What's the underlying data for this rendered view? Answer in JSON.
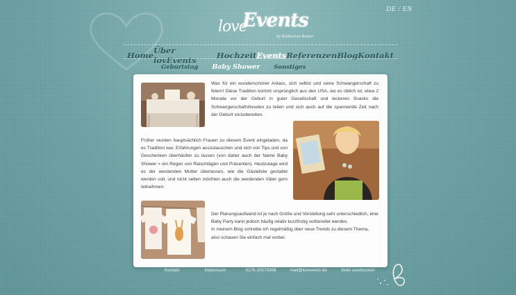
{
  "lang": {
    "de": "DE",
    "separator": "/",
    "en": "EN"
  },
  "logo": {
    "love": "love",
    "events": "Events",
    "byline": "by Katharina Romer"
  },
  "nav": [
    {
      "label": "Home",
      "active": false
    },
    {
      "label": "Über lovEvents",
      "active": false
    },
    {
      "label": "Hochzeit",
      "active": false
    },
    {
      "label": "Events",
      "active": true
    },
    {
      "label": "Referenzen",
      "active": false
    },
    {
      "label": "Blog",
      "active": false
    },
    {
      "label": "Kontakt",
      "active": false
    }
  ],
  "subnav": [
    {
      "label": "Geburtstag",
      "active": false
    },
    {
      "label": "Baby Shower",
      "active": true
    },
    {
      "label": "Sonstiges",
      "active": false
    }
  ],
  "content": {
    "para1": "Was für ein wunderschöner Anlass, sich selbst und seine Schwangerschaft zu feiern! Diese Tradition kommt ursprünglich aus den USA, wo es üblich ist, etwa 2 Monate vor der Geburt in guter Gesellschaft und leckeren Snacks die Schwangerschaftsfreuden zu teilen und sich auch auf die spannende Zeit nach der Geburt vorzubereiten.",
    "para2": "Früher wurden hauptsächlich Frauen zu diesem Event eingeladen, da es Tradition war, Erfahrungen auszutauschen und sich von Tips und von Geschenken überhäufen zu lassen (von daher auch der Name Baby Shower = ein Regen von Ratschlägen und Präsenten). Heutzutage wird es der werdenden Mutter überlassen, wie die Gästeliste gestaltet werden soll, und nicht selten möchten auch die werdenden Väter gern teilnehmen.",
    "para3a": "Der Planungsaufwand ist je nach Größe und Vorstellung sehr unterschiedlich, eine Baby Party kann jedoch häufig relativ kurzfristig vorbereitet werden.",
    "para3b": "In meinem Blog schreibe ich regelmäßig über neue Trends zu diesem Thema, also schauen Sie einfach mal vorbei."
  },
  "footer": {
    "kontakt": "Kontakt",
    "impressum": "Impressum",
    "phone": "0176-20079308",
    "email": "mail@loveventz.de",
    "print": "Seite ausdrucken"
  },
  "colors": {
    "background": "#6fa3a6",
    "nav_text": "#2e5c5e",
    "panel": "#fdfdfd"
  }
}
